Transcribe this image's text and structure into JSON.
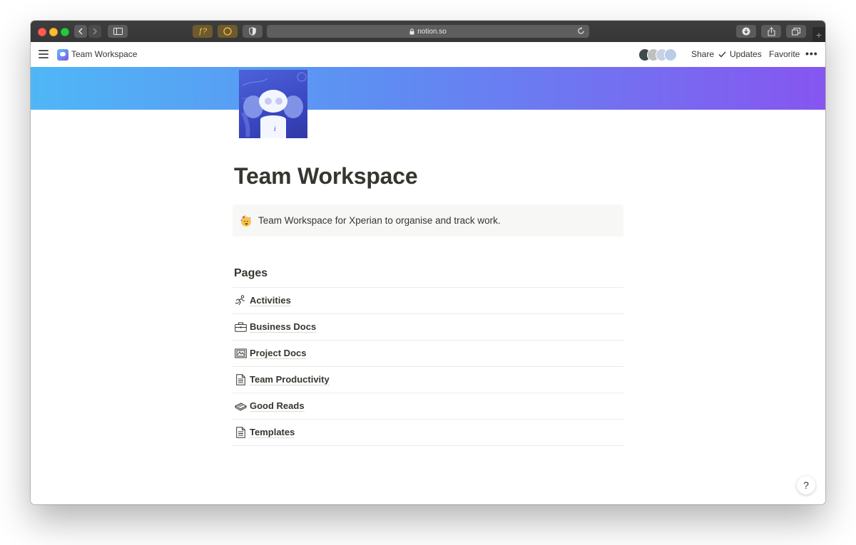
{
  "browser": {
    "address": "notion.so",
    "icons": [
      "back-icon",
      "forward-icon",
      "sidebar-icon",
      "extension-icon",
      "extension-icon",
      "shield-icon",
      "lock-icon",
      "reload-icon",
      "download-icon",
      "share-icon",
      "tabs-icon",
      "new-tab-icon"
    ],
    "ext_label": "ƒ?"
  },
  "topbar": {
    "breadcrumb": "Team Workspace",
    "share": "Share",
    "updates": "Updates",
    "favorite": "Favorite",
    "more": "•••"
  },
  "page": {
    "title": "Team Workspace",
    "callout": "Team Workspace for Xperian to organise and track work.",
    "pages_heading": "Pages",
    "items": [
      {
        "label": "Activities",
        "icon": "running-icon"
      },
      {
        "label": "Business Docs",
        "icon": "briefcase-icon"
      },
      {
        "label": "Project Docs",
        "icon": "blueprint-icon"
      },
      {
        "label": "Team Productivity",
        "icon": "document-icon"
      },
      {
        "label": "Good Reads",
        "icon": "books-icon"
      },
      {
        "label": "Templates",
        "icon": "document-icon"
      }
    ]
  },
  "help": "?",
  "colors": {
    "cover_start": "#4fb7f6",
    "cover_end": "#8656f0",
    "text": "#37352f",
    "callout_bg": "#f7f7f5"
  }
}
